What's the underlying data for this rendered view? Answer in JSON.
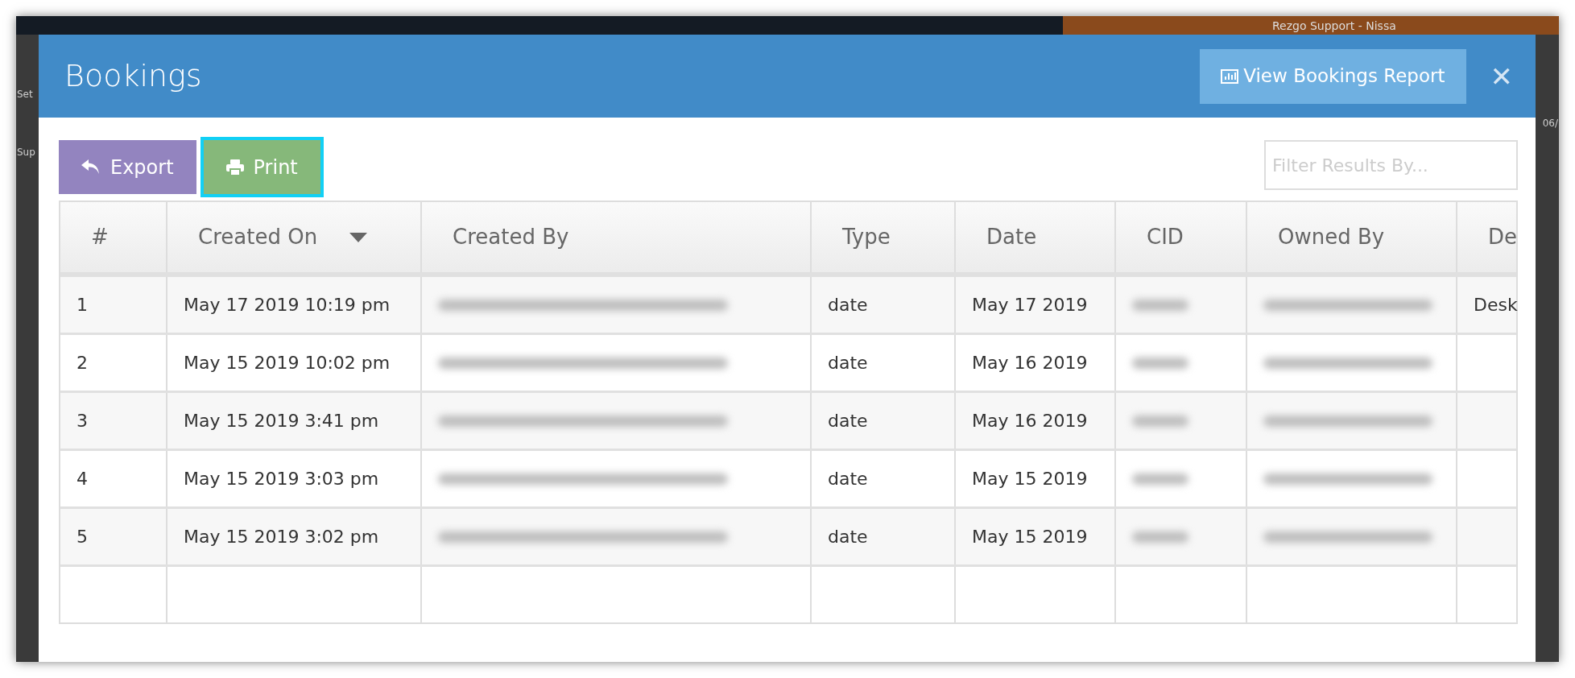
{
  "background": {
    "user": "Rezgo Support - Nissa",
    "left_fragments": [
      "Set",
      "Sup"
    ],
    "right_fragment": "06/"
  },
  "modal": {
    "title": "Bookings",
    "report_button": "View Bookings Report",
    "close": "✕"
  },
  "toolbar": {
    "buttons": [
      {
        "kind": "export",
        "label": "Export",
        "highlighted": false
      },
      {
        "kind": "print",
        "label": "Print",
        "highlighted": true
      }
    ],
    "filter": {
      "placeholder": "Filter Results By..."
    }
  },
  "table": {
    "columns": [
      {
        "label": "#",
        "kind": "text"
      },
      {
        "label": "Created On",
        "kind": "text",
        "sorted": true
      },
      {
        "label": "Created By",
        "kind": "blurred"
      },
      {
        "label": "Type",
        "kind": "text"
      },
      {
        "label": "Date",
        "kind": "text"
      },
      {
        "label": "CID",
        "kind": "blurred"
      },
      {
        "label": "Owned By",
        "kind": "blurred"
      },
      {
        "label": "De",
        "kind": "text"
      }
    ],
    "rows": [
      {
        "cells": [
          "1",
          "May 17 2019 10:19 pm",
          "",
          "date",
          "May 17 2019",
          "",
          "",
          "Desk"
        ]
      },
      {
        "cells": [
          "2",
          "May 15 2019 10:02 pm",
          "",
          "date",
          "May 16 2019",
          "",
          "",
          ""
        ]
      },
      {
        "cells": [
          "3",
          "May 15 2019 3:41 pm",
          "",
          "date",
          "May 16 2019",
          "",
          "",
          ""
        ]
      },
      {
        "cells": [
          "4",
          "May 15 2019 3:03 pm",
          "",
          "date",
          "May 15 2019",
          "",
          "",
          ""
        ]
      },
      {
        "cells": [
          "5",
          "May 15 2019 3:02 pm",
          "",
          "date",
          "May 15 2019",
          "",
          "",
          ""
        ]
      }
    ]
  }
}
